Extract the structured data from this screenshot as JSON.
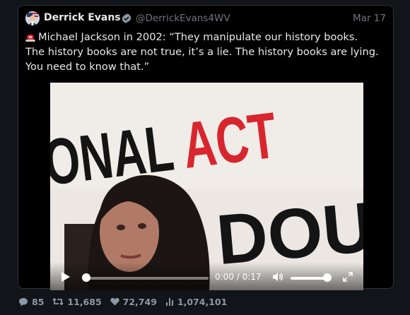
{
  "author": {
    "name": "Derrick Evans",
    "handle": "@DerrickEvans4WV",
    "verified_badge": "verified-badge-icon",
    "date": "Mar 17"
  },
  "tweet": {
    "alarm_icon": "police-siren-icon",
    "text": "Michael Jackson in 2002: “They manipulate our history books. The history books are not true, it’s a lie. The history books are lying. You need to know that.”"
  },
  "video": {
    "banner_line1_prefix": "ONAL ",
    "banner_line1_red": "ACT",
    "banner_line2": "DOU",
    "time": "0:00 / 0:17",
    "progress_fraction": 0.0,
    "volume_fraction": 1.0
  },
  "stats": {
    "replies": "85",
    "retweets": "11,685",
    "likes": "72,749",
    "views": "1,074,101"
  },
  "colors": {
    "background": "#111418",
    "card": "#000000",
    "text": "#e7e9ea",
    "muted": "#71767b",
    "verified": "#1d9bf0",
    "banner_red": "#d8262e"
  }
}
